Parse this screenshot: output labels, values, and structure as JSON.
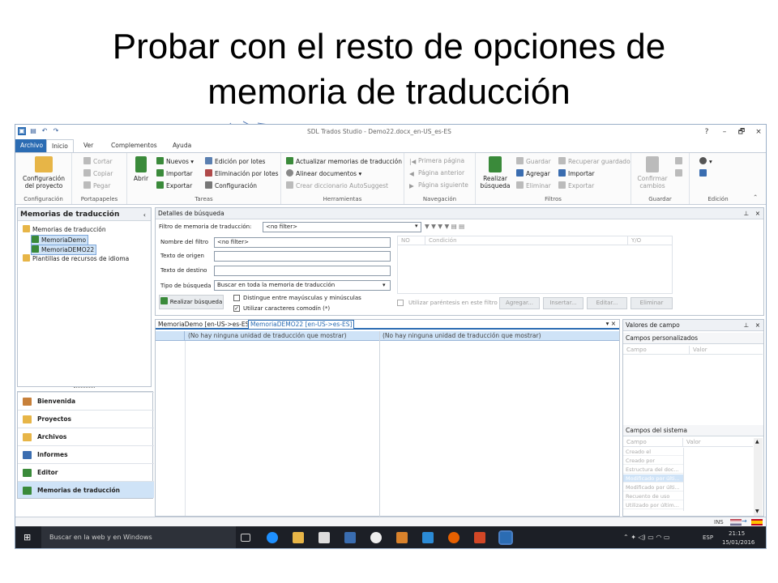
{
  "slide": {
    "title_line1": "Probar con el resto de opciones de",
    "title_line2": "memoria de traducción"
  },
  "window": {
    "title": "SDL Trados Studio - Demo22.docx_en-US_es-ES",
    "controls": [
      "?",
      "–",
      "🗗",
      "×"
    ]
  },
  "tabs": {
    "file": "Archivo",
    "home": "Inicio",
    "view": "Ver",
    "addins": "Complementos",
    "help": "Ayuda"
  },
  "ribbon": {
    "config": {
      "big": "Configuración del proyecto",
      "group": "Configuración"
    },
    "clipboard": {
      "cut": "Cortar",
      "copy": "Copiar",
      "paste": "Pegar",
      "group": "Portapapeles"
    },
    "tasks": {
      "open": "Abrir",
      "new": "Nuevos",
      "import": "Importar",
      "export": "Exportar",
      "batch_edit": "Edición por lotes",
      "batch_delete": "Eliminación por lotes",
      "settings": "Configuración",
      "group": "Tareas"
    },
    "tools": {
      "update": "Actualizar memorias de traducción",
      "align": "Alinear documentos",
      "autosuggest": "Crear diccionario AutoSuggest",
      "group": "Herramientas"
    },
    "navigation": {
      "first": "Primera página",
      "prev": "Página anterior",
      "next": "Página siguiente",
      "group": "Navegación"
    },
    "filters": {
      "search": "Realizar búsqueda",
      "save": "Guardar",
      "add": "Agregar",
      "delete": "Eliminar",
      "recover": "Recuperar guardado",
      "import": "Importar",
      "export": "Exportar",
      "group": "Filtros"
    },
    "save": {
      "big": "Confirmar cambios",
      "group": "Guardar"
    },
    "edit": {
      "group": "Edición"
    }
  },
  "left_panel": {
    "title": "Memorias de traducción",
    "tree_root": "Memorias de traducción",
    "tm1": "MemoriaDemo",
    "tm2": "MemoriaDEMO22",
    "templates": "Plantillas de recursos de idioma"
  },
  "nav": {
    "welcome": "Bienvenida",
    "projects": "Proyectos",
    "files": "Archivos",
    "reports": "Informes",
    "editor": "Editor",
    "tms": "Memorias de traducción"
  },
  "search_details": {
    "header": "Detalles de búsqueda",
    "filter_label": "Filtro de memoria de traducción:",
    "filter_value": "<no filter>",
    "filter_name_label": "Nombre del filtro",
    "filter_name_value": "<no filter>",
    "source_label": "Texto de origen",
    "target_label": "Texto de destino",
    "search_type_label": "Tipo de búsqueda",
    "search_type_value": "Buscar en toda la memoria de traducción",
    "search_button": "Realizar búsqueda",
    "case_option": "Distingue entre mayúsculas y minúsculas",
    "wildcard_option": "Utilizar caracteres comodín (*)",
    "paren_option": "Utilizar paréntesis en este filtro",
    "col_no": "NO",
    "col_condition": "Condición",
    "col_yo": "Y/O",
    "btn_add": "Agregar...",
    "btn_insert": "Insertar...",
    "btn_edit": "Editar...",
    "btn_delete": "Eliminar"
  },
  "results": {
    "tab1": "MemoriaDemo [en-US->es-ES]",
    "tab2": "MemoriaDEMO22 [en-US->es-ES]",
    "empty_left": "(No hay ninguna unidad de traducción que mostrar)",
    "empty_right": "(No hay ninguna unidad de traducción que mostrar)"
  },
  "field_values": {
    "title": "Valores de campo",
    "custom_title": "Campos personalizados",
    "col_field": "Campo",
    "col_value": "Valor",
    "system_title": "Campos del sistema",
    "system_rows": [
      "Creado el",
      "Creado por",
      "Estructura del doc...",
      "Modificado por últi...",
      "Modificado por últi...",
      "Recuento de uso",
      "Utilizado por últim..."
    ]
  },
  "status": {
    "ins": "INS"
  },
  "taskbar": {
    "search": "Buscar en la web y en Windows",
    "lang": "ESP",
    "time": "21:15",
    "date": "15/01/2016"
  }
}
